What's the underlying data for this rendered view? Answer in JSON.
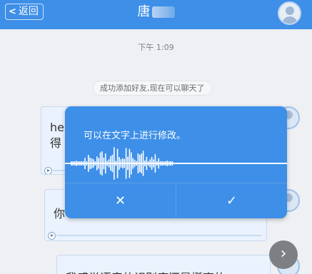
{
  "header": {
    "back_label": "返回",
    "title": "唐"
  },
  "chat": {
    "timestamp": "下午 1:09",
    "notice": "成功添加好友,现在可以聊天了",
    "messages": [
      {
        "visible_text": "he\n得"
      },
      {
        "visible_text": "你"
      },
      {
        "visible_text": "我感觉语音的识别度还是挺高的"
      }
    ]
  },
  "dialog": {
    "hint": "可以在文字上进行修改。",
    "cancel_symbol": "✕",
    "confirm_symbol": "✓"
  },
  "scroll_button_symbol": "›",
  "colors": {
    "header_bg": "#3d8fe8",
    "dialog_bg": "#3d8fe8",
    "chat_bg": "#eef0f3",
    "bubble_bg": "#eaf2fd"
  },
  "icons": {
    "back": "chevron-left-icon",
    "avatar": "user-avatar-icon",
    "play": "play-icon",
    "scroll": "chevron-right-icon",
    "cancel": "close-icon",
    "confirm": "check-icon"
  }
}
